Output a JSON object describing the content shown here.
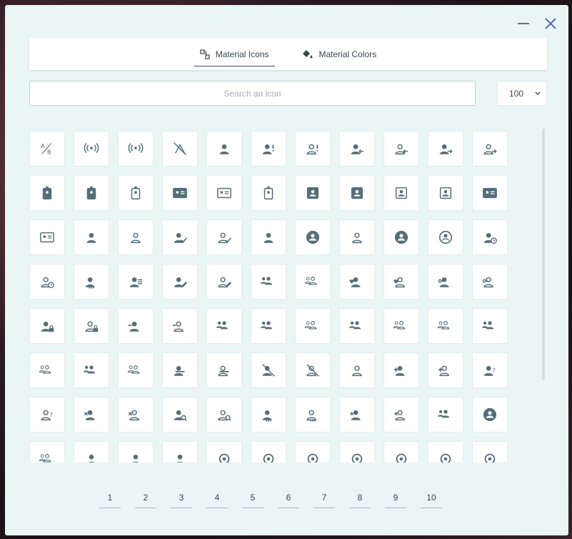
{
  "window": {
    "minimize_icon": "minimize-icon",
    "close_icon": "close-icon"
  },
  "tabs": [
    {
      "label": "Material Icons",
      "icon": "icon-grid-icon",
      "active": true
    },
    {
      "label": "Material Colors",
      "icon": "paint-bucket-icon",
      "active": false
    }
  ],
  "search": {
    "placeholder": "Search an icon",
    "value": ""
  },
  "page_size": {
    "value": "100"
  },
  "icons": [
    "ab-testing",
    "broadcast",
    "router-broadcast",
    "antenna-off",
    "account",
    "account-alert",
    "account-alert-outline",
    "account-arrow-left",
    "account-arrow-left-outline",
    "account-arrow-right",
    "account-arrow-right-outline",
    "badge-account",
    "badge-account-alert",
    "badge-account-alert-outline",
    "card-account-details",
    "card-account-details-outline",
    "badge-account-outline",
    "account-box",
    "account-box-multiple",
    "account-box-multiple-outline",
    "account-box-outline",
    "card-account-details-star",
    "card-account-details-star-outline",
    "account-cash",
    "account-cash-outline",
    "account-check",
    "account-check-outline",
    "account-child",
    "account-child-circle",
    "account-child-outline",
    "account-circle",
    "account-circle-outline",
    "account-clock",
    "account-clock-outline",
    "account-cog",
    "account-details",
    "account-edit",
    "account-edit-outline",
    "account-group",
    "account-group-outline",
    "account-heart",
    "account-heart-outline",
    "account-key",
    "account-key-outline",
    "account-lock",
    "account-lock-outline",
    "account-minus",
    "account-minus-outline",
    "account-multiple",
    "account-multiple-check",
    "account-multiple-check-outline",
    "account-multiple-minus",
    "account-multiple-minus-outline",
    "account-multiple-outline",
    "account-multiple-plus",
    "account-multiple-plus-outline",
    "account-multiple-remove",
    "account-multiple-remove-outline",
    "account-music",
    "account-music-outline",
    "account-off",
    "account-off-outline",
    "account-outline",
    "account-plus",
    "account-plus-outline",
    "account-question",
    "account-question-outline",
    "account-remove",
    "account-remove-outline",
    "account-search",
    "account-search-outline",
    "account-settings",
    "account-settings-outline",
    "account-star",
    "account-star-outline",
    "account-supervisor",
    "account-supervisor-circle",
    "account-supervisor-outline",
    "account-switch",
    "account-tie",
    "account-voice",
    "adjust",
    "adobe",
    "adobe-acrobat",
    "adobe",
    "air-conditioner",
    "air-filter",
    "airbag"
  ],
  "pagination": [
    "1",
    "2",
    "3",
    "4",
    "5",
    "6",
    "7",
    "8",
    "9",
    "10"
  ],
  "colors": {
    "accent": "#5c6bc0",
    "icon": "#546e7a",
    "background": "#eaf6f5"
  }
}
